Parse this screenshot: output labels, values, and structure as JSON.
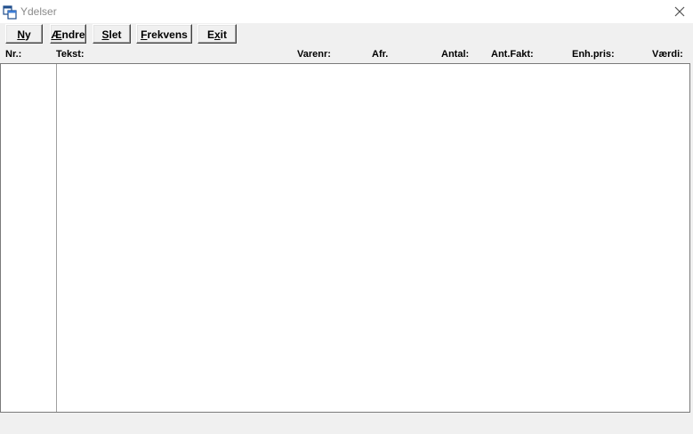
{
  "window": {
    "title": "Ydelser",
    "app_icon": "windows-app-icon",
    "close_icon": "close-icon"
  },
  "toolbar": {
    "buttons": [
      {
        "label": "Ny",
        "mnemonic": "N"
      },
      {
        "label": "Ændre",
        "mnemonic": "Æ"
      },
      {
        "label": "Slet",
        "mnemonic": "S"
      },
      {
        "label": "Frekvens",
        "mnemonic": "F"
      },
      {
        "label": "Exit",
        "mnemonic": "x"
      }
    ]
  },
  "columns": [
    "Nr.:",
    "Tekst:",
    "Varenr:",
    "Afr.",
    "Antal:",
    "Ant.Fakt:",
    "Enh.pris:",
    "Værdi:"
  ],
  "rows": []
}
